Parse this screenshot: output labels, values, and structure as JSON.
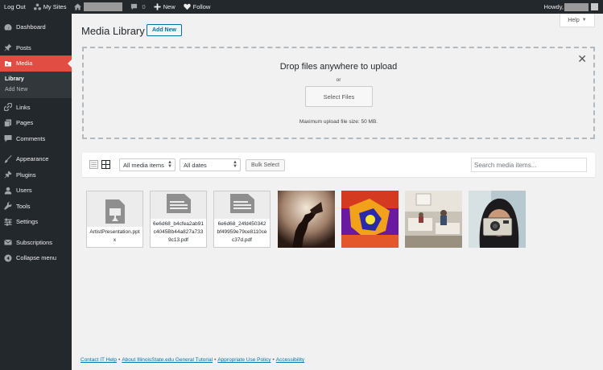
{
  "adminbar": {
    "logout": "Log Out",
    "mysites": "My Sites",
    "comments_count": "0",
    "new": "New",
    "follow": "Follow",
    "howdy": "Howdy,"
  },
  "sidebar": {
    "items": [
      {
        "label": "Dashboard",
        "icon": "dashboard-icon"
      },
      {
        "label": "Posts",
        "icon": "pin-icon"
      },
      {
        "label": "Media",
        "icon": "media-icon"
      },
      {
        "label": "Links",
        "icon": "link-icon"
      },
      {
        "label": "Pages",
        "icon": "pages-icon"
      },
      {
        "label": "Comments",
        "icon": "comment-icon"
      },
      {
        "label": "Appearance",
        "icon": "brush-icon"
      },
      {
        "label": "Plugins",
        "icon": "plug-icon"
      },
      {
        "label": "Users",
        "icon": "user-icon"
      },
      {
        "label": "Tools",
        "icon": "wrench-icon"
      },
      {
        "label": "Settings",
        "icon": "sliders-icon"
      },
      {
        "label": "Subscriptions",
        "icon": "mail-icon"
      },
      {
        "label": "Collapse menu",
        "icon": "collapse-icon"
      }
    ],
    "media_submenu": [
      "Library",
      "Add New"
    ]
  },
  "main": {
    "help": "Help",
    "title": "Media Library",
    "add_new": "Add New",
    "uploader": {
      "title": "Drop files anywhere to upload",
      "or": "or",
      "select_files": "Select Files",
      "max_size": "Maximum upload file size: 50 MB."
    },
    "toolbar": {
      "filter_type": "All media items",
      "filter_date": "All dates",
      "bulk_select": "Bulk Select",
      "search_placeholder": "Search media items..."
    },
    "attachments": [
      {
        "type": "document",
        "filename": "ArtistPresentation.pptx"
      },
      {
        "type": "document",
        "filename": "6e6d68_b4cfea2ab91c4045Bb44a827a7339c13.pdf"
      },
      {
        "type": "document",
        "filename": "6e6d68_24fd450342bf49959e79ce8110cec37d.pdf"
      },
      {
        "type": "image"
      },
      {
        "type": "image"
      },
      {
        "type": "image"
      },
      {
        "type": "image"
      }
    ]
  },
  "footer": {
    "links": [
      "Contact IT Help",
      "About IllinoisState.edu General Tutorial",
      "Appropriate Use Policy",
      "Accessibility"
    ]
  },
  "colors": {
    "adminbar": "#23282d",
    "sidebar": "#23282d",
    "active_menu": "#e14d43",
    "link": "#0073aa"
  }
}
